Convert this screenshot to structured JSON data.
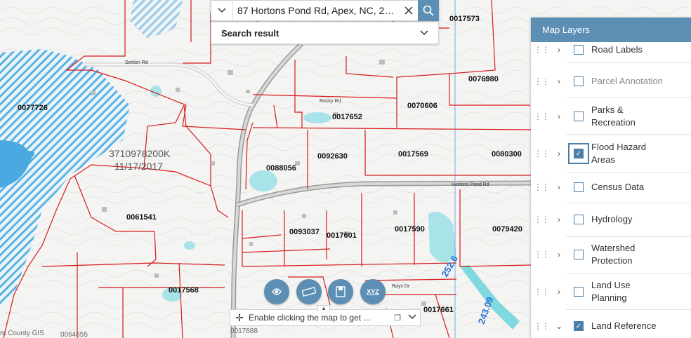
{
  "search": {
    "value": "87 Hortons Pond Rd, Apex, NC, 27...",
    "result_label": "Search result"
  },
  "map": {
    "parcels": [
      "0017573",
      "0076980",
      "0077726",
      "0017652",
      "0070606",
      "0092630",
      "0017569",
      "0080300",
      "0088056",
      "0061541",
      "0093037",
      "0017601",
      "0017590",
      "0079420",
      "0017568",
      "0017661",
      "0017688",
      "0064655"
    ],
    "roads": [
      "Sexton Rd",
      "Rocky Rd",
      "Hortons Pond Rd",
      "Rays Dr"
    ],
    "stamp_id": "3710978200K",
    "stamp_date": "11/17/2017",
    "elevations": [
      "252.6",
      "243.09"
    ],
    "attribution": "m County GIS"
  },
  "layers": {
    "title": "Map Layers",
    "items": [
      {
        "label": "Road Labels",
        "checked": false
      },
      {
        "label": "Parcel Annotation",
        "checked": false
      },
      {
        "label": "Parks & Recreation",
        "checked": false
      },
      {
        "label": "Flood Hazard Areas",
        "checked": true
      },
      {
        "label": "Census Data",
        "checked": false
      },
      {
        "label": "Hydrology",
        "checked": false
      },
      {
        "label": "Watershed Protection",
        "checked": false
      },
      {
        "label": "Land Use Planning",
        "checked": false
      },
      {
        "label": "Land Reference",
        "checked": true
      }
    ]
  },
  "toolbar": {
    "xyz_label": "XYZ",
    "status_text": "Enable clicking the map to get ..."
  },
  "colors": {
    "accent": "#5c8fb3",
    "parcel_line": "#d7191c",
    "flood_hatch": "#4aa9e0",
    "water": "#9fe0e6"
  }
}
